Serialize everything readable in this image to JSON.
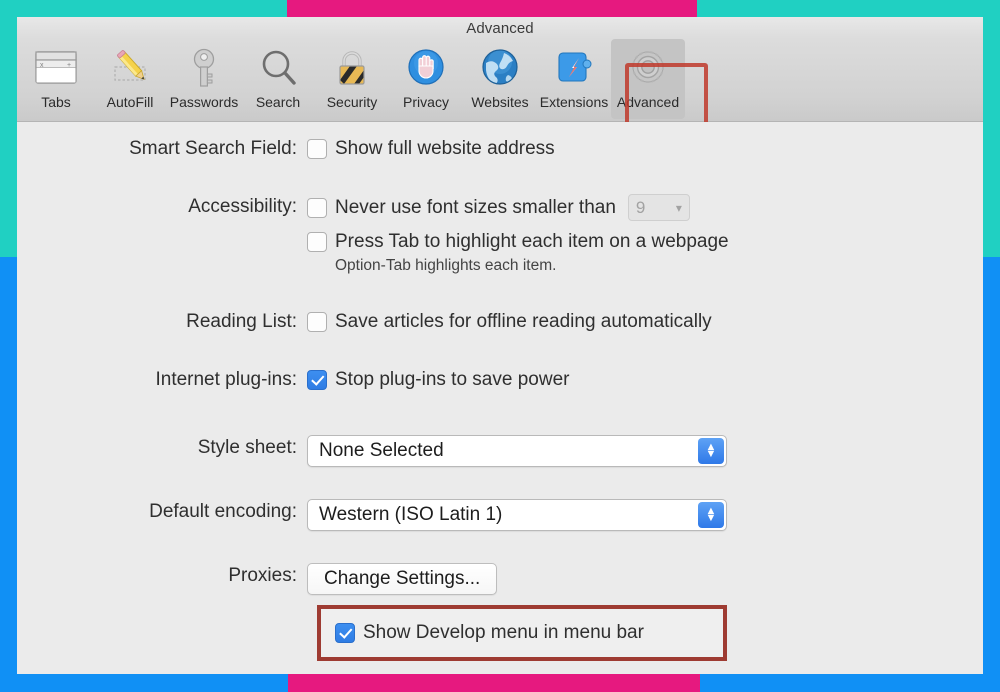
{
  "window": {
    "title": "Advanced"
  },
  "toolbar": {
    "items": [
      {
        "label": "Tabs",
        "icon": "tabs-icon",
        "selected": false
      },
      {
        "label": "AutoFill",
        "icon": "autofill-icon",
        "selected": false
      },
      {
        "label": "Passwords",
        "icon": "passwords-icon",
        "selected": false
      },
      {
        "label": "Search",
        "icon": "search-icon",
        "selected": false
      },
      {
        "label": "Security",
        "icon": "security-icon",
        "selected": false
      },
      {
        "label": "Privacy",
        "icon": "privacy-icon",
        "selected": false
      },
      {
        "label": "Websites",
        "icon": "websites-icon",
        "selected": false
      },
      {
        "label": "Extensions",
        "icon": "extensions-icon",
        "selected": false
      },
      {
        "label": "Advanced",
        "icon": "advanced-icon",
        "selected": true
      }
    ]
  },
  "prefs": {
    "smart_search": {
      "label": "Smart Search Field:",
      "checkbox_label": "Show full website address",
      "checked": false
    },
    "accessibility": {
      "label": "Accessibility:",
      "font_size_label": "Never use font sizes smaller than",
      "font_size_checked": false,
      "font_size_value": "9",
      "tab_highlight_label": "Press Tab to highlight each item on a webpage",
      "tab_highlight_checked": false,
      "hint": "Option-Tab highlights each item."
    },
    "reading_list": {
      "label": "Reading List:",
      "checkbox_label": "Save articles for offline reading automatically",
      "checked": false
    },
    "internet_plugins": {
      "label": "Internet plug-ins:",
      "checkbox_label": "Stop plug-ins to save power",
      "checked": true
    },
    "style_sheet": {
      "label": "Style sheet:",
      "value": "None Selected"
    },
    "default_encoding": {
      "label": "Default encoding:",
      "value": "Western (ISO Latin 1)"
    },
    "proxies": {
      "label": "Proxies:",
      "button_label": "Change Settings..."
    },
    "develop_menu": {
      "checkbox_label": "Show Develop menu in menu bar",
      "checked": true
    }
  },
  "annotations": {
    "highlight_color": "#c0392b",
    "develop_highlight_color": "#9e3b32"
  },
  "frame": {
    "teal": "#20d0c2",
    "pink": "#e6197f",
    "blue": "#1090f5"
  }
}
